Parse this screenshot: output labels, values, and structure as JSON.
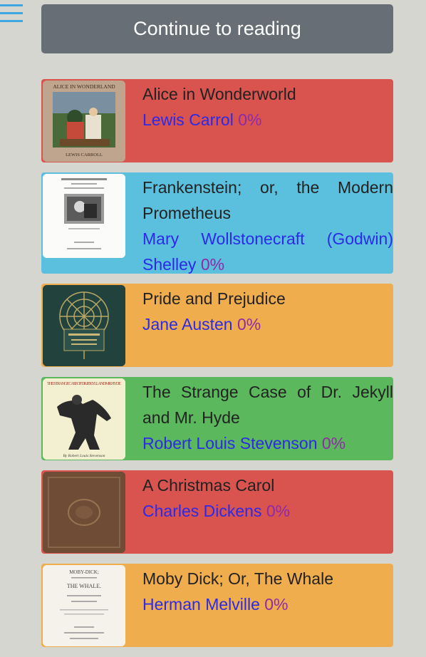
{
  "header": {
    "continue_label": "Continue to reading"
  },
  "colors": {
    "red": "#d9534f",
    "blue": "#5bc0de",
    "orange": "#f0ad4e",
    "green": "#5cb85c",
    "button": "#676e75",
    "author": "#2a2ae8",
    "progress": "#8e2aa8"
  },
  "books": [
    {
      "title": "Alice in Wonderworld",
      "author": "Lewis Carrol",
      "progress": "0%",
      "color": "#d9534f",
      "cover_title": "ALICE IN WONDERLAND",
      "cover_author": "LEWIS CARROLL"
    },
    {
      "title": "Frankenstein; or, the Modern Prometheus",
      "author": "Mary Wollstonecraft (Godwin) Shelley",
      "progress": "0%",
      "color": "#5bc0de"
    },
    {
      "title": "Pride and Prejudice",
      "author": "Jane Austen",
      "progress": "0%",
      "color": "#f0ad4e"
    },
    {
      "title": "The Strange Case of Dr. Jekyll and Mr. Hyde",
      "author": "Robert Louis Stevenson",
      "progress": "0%",
      "color": "#5cb85c",
      "cover_title": "THE STRANGE CASE OF DR. JEKYLL AND MR. HYDE",
      "cover_author": "By Robert Louis Stevenson"
    },
    {
      "title": "A Christmas Carol",
      "author": "Charles Dickens",
      "progress": "0%",
      "color": "#d9534f"
    },
    {
      "title": "Moby Dick; Or, The Whale",
      "author": "Herman Melville",
      "progress": "0%",
      "color": "#f0ad4e",
      "cover_title": "MOBY-DICK;",
      "cover_subtitle": "THE WHALE."
    }
  ]
}
